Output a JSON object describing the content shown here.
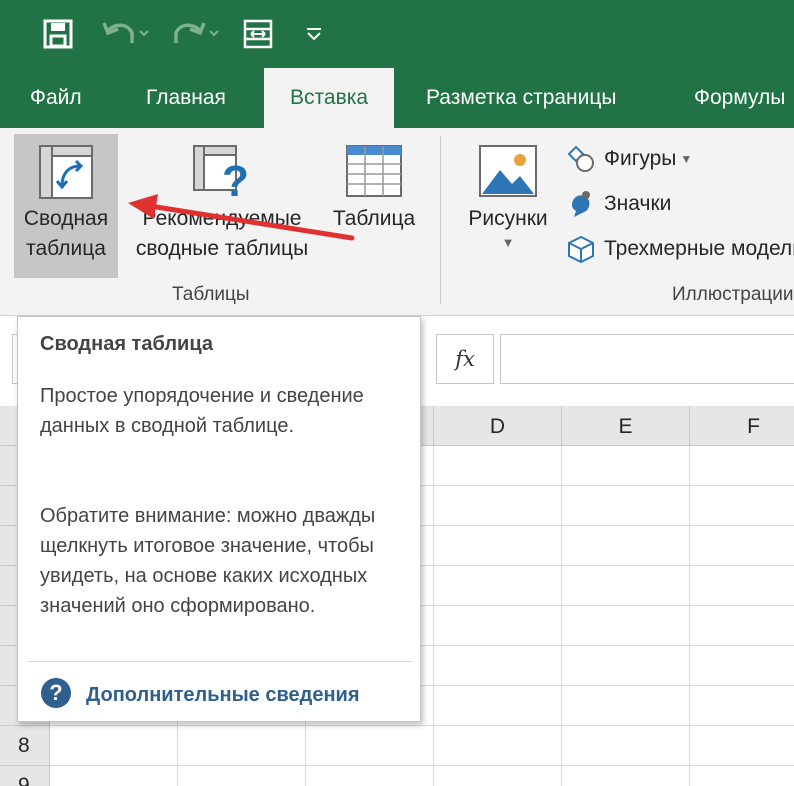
{
  "qat": {
    "icons": [
      "save-icon",
      "undo-icon",
      "redo-icon",
      "form-icon",
      "customize-qat-icon"
    ]
  },
  "tabs": [
    {
      "label": "Файл"
    },
    {
      "label": "Главная"
    },
    {
      "label": "Вставка",
      "active": true
    },
    {
      "label": "Разметка страницы"
    },
    {
      "label": "Формулы"
    }
  ],
  "ribbon": {
    "tables_group": {
      "label": "Таблицы",
      "pivot_table": {
        "line1": "Сводная",
        "line2": "таблица"
      },
      "recommended_pivot": {
        "line1": "Рекомендуемые",
        "line2": "сводные таблицы"
      },
      "table": {
        "label": "Таблица"
      }
    },
    "illustrations_group": {
      "label": "Иллюстрации",
      "pictures": {
        "label": "Рисунки"
      },
      "shapes": {
        "label": "Фигуры"
      },
      "icons": {
        "label": "Значки"
      },
      "models_3d": {
        "label": "Трехмерные модели"
      }
    }
  },
  "formula_bar": {
    "fx_label": "fx"
  },
  "grid": {
    "columns": [
      "D",
      "E",
      "F"
    ],
    "rows": [
      "8",
      "9"
    ]
  },
  "tooltip": {
    "title": "Сводная таблица",
    "paragraph1": "Простое упорядочение и сведение данных в сводной таблице.",
    "paragraph2": "Обратите внимание: можно дважды щелкнуть итоговое значение, чтобы увидеть, на основе каких исходных значений оно сформировано.",
    "more_info": "Дополнительные сведения"
  },
  "colors": {
    "excel_green": "#217346",
    "annotation_arrow": "#e03131",
    "help_icon": "#2f5f8f"
  }
}
